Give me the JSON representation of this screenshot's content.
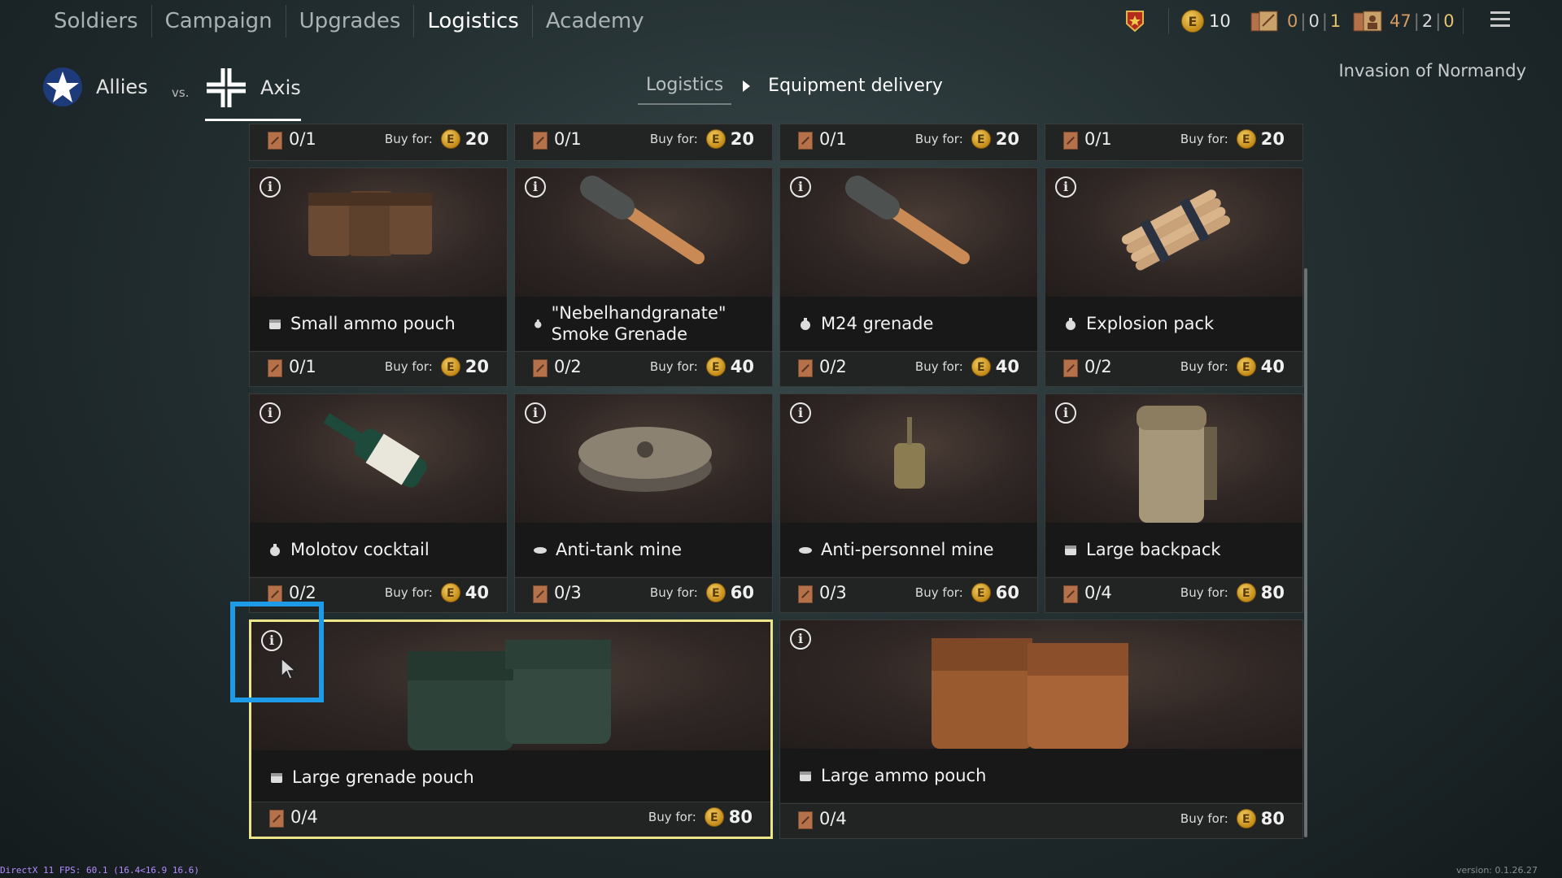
{
  "nav": {
    "tabs": [
      "Soldiers",
      "Campaign",
      "Upgrades",
      "Logistics",
      "Academy"
    ],
    "active_tab": "Logistics"
  },
  "resources": {
    "gold": "10",
    "tickets_a": [
      "0",
      "0",
      "1"
    ],
    "tickets_b": [
      "47",
      "2",
      "0"
    ]
  },
  "factions": {
    "left": "Allies",
    "vs": "vs.",
    "right": "Axis"
  },
  "breadcrumb": {
    "parent": "Logistics",
    "current": "Equipment delivery"
  },
  "mission": "Invasion of Normandy",
  "buy_label": "Buy for:",
  "top_row": [
    {
      "count": "0/1",
      "price": "20"
    },
    {
      "count": "0/1",
      "price": "20"
    },
    {
      "count": "0/1",
      "price": "20"
    },
    {
      "count": "0/1",
      "price": "20"
    }
  ],
  "items": [
    {
      "name": "Small ammo pouch",
      "type_icon": "pouch-icon",
      "count": "0/1",
      "price": "20"
    },
    {
      "name": "\"Nebelhandgranate\" Smoke Grenade",
      "type_icon": "grenade-icon",
      "count": "0/2",
      "price": "40"
    },
    {
      "name": "M24 grenade",
      "type_icon": "grenade-icon",
      "count": "0/2",
      "price": "40"
    },
    {
      "name": "Explosion pack",
      "type_icon": "grenade-icon",
      "count": "0/2",
      "price": "40"
    },
    {
      "name": "Molotov cocktail",
      "type_icon": "grenade-icon",
      "count": "0/2",
      "price": "40"
    },
    {
      "name": "Anti-tank mine",
      "type_icon": "mine-icon",
      "count": "0/3",
      "price": "60"
    },
    {
      "name": "Anti-personnel mine",
      "type_icon": "mine-icon",
      "count": "0/3",
      "price": "60"
    },
    {
      "name": "Large backpack",
      "type_icon": "pouch-icon",
      "count": "0/4",
      "price": "80"
    },
    {
      "name": "Large grenade pouch",
      "type_icon": "pouch-icon",
      "count": "0/4",
      "price": "80"
    },
    {
      "name": "Large ammo pouch",
      "type_icon": "pouch-icon",
      "count": "0/4",
      "price": "80"
    }
  ],
  "info_glyph": "i",
  "coin_glyph": "E",
  "fps": "DirectX 11 FPS: 60.1 (16.4<16.9 16.6)",
  "version": "version: 0.1.26.27",
  "colors": {
    "selected_border": "#ece58a",
    "highlight": "#1d9be6",
    "coin": "#d9a62a"
  }
}
